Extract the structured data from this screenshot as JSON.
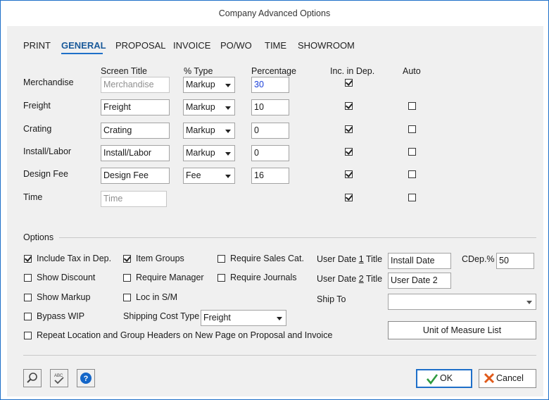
{
  "window": {
    "title": "Company Advanced Options"
  },
  "tabs": [
    "PRINT",
    "GENERAL",
    "PROPOSAL",
    "INVOICE",
    "PO/WO",
    "TIME",
    "SHOWROOM"
  ],
  "active_tab": "GENERAL",
  "columns": {
    "screen_title": "Screen Title",
    "type": "% Type",
    "percentage": "Percentage",
    "inc_in_dep": "Inc. in Dep.",
    "auto": "Auto"
  },
  "rows": [
    {
      "label": "Merchandise",
      "screen_title": "Merchandise",
      "type": "Markup",
      "percentage": "30",
      "inc_in_dep": true,
      "auto": null
    },
    {
      "label": "Freight",
      "screen_title": "Freight",
      "type": "Markup",
      "percentage": "10",
      "inc_in_dep": true,
      "auto": false
    },
    {
      "label": "Crating",
      "screen_title": "Crating",
      "type": "Markup",
      "percentage": "0",
      "inc_in_dep": true,
      "auto": false
    },
    {
      "label": "Install/Labor",
      "screen_title": "Install/Labor",
      "type": "Markup",
      "percentage": "0",
      "inc_in_dep": true,
      "auto": false
    },
    {
      "label": "Design Fee",
      "screen_title": "Design Fee",
      "type": "Fee",
      "percentage": "16",
      "inc_in_dep": true,
      "auto": false
    },
    {
      "label": "Time",
      "screen_title": "Time",
      "type": null,
      "percentage": null,
      "inc_in_dep": true,
      "auto": false
    }
  ],
  "options": {
    "heading": "Options",
    "include_tax_in_dep": {
      "label": "Include Tax in Dep.",
      "checked": true
    },
    "show_discount": {
      "label": "Show Discount",
      "checked": false
    },
    "show_markup": {
      "label": "Show Markup",
      "checked": false
    },
    "bypass_wip": {
      "label": "Bypass WIP",
      "checked": false
    },
    "item_groups": {
      "label": "Item Groups",
      "checked": true
    },
    "require_manager": {
      "label": "Require Manager",
      "checked": false
    },
    "loc_in_sm": {
      "label": "Loc in S/M",
      "checked": false
    },
    "require_sales_cat": {
      "label": "Require Sales Cat.",
      "checked": false
    },
    "require_journals": {
      "label": "Require Journals",
      "checked": false
    },
    "repeat_headers": {
      "label": "Repeat Location and Group Headers on New Page on Proposal and Invoice",
      "checked": false
    },
    "shipping_cost_type": {
      "label": "Shipping Cost Type",
      "value": "Freight"
    },
    "user_date_1": {
      "label_pre": "User Date ",
      "label_key": "1",
      "label_post": " Title",
      "value": "Install Date"
    },
    "user_date_2": {
      "label_pre": "User Date ",
      "label_key": "2",
      "label_post": " Title",
      "value": "User Date 2"
    },
    "cdep": {
      "label": "CDep.%",
      "value": "50"
    },
    "ship_to": {
      "label": "Ship To",
      "value": ""
    },
    "unit_of_measure_button": "Unit of Measure List"
  },
  "footer": {
    "ok_label": "OK",
    "cancel_label": "Cancel",
    "icons": [
      "search-icon",
      "spellcheck-icon",
      "help-icon"
    ]
  },
  "colors": {
    "accent": "#1e6fc9",
    "ok_check": "#2e9b3f",
    "cancel_x": "#e05a1a",
    "help_blue": "#1466c8"
  }
}
